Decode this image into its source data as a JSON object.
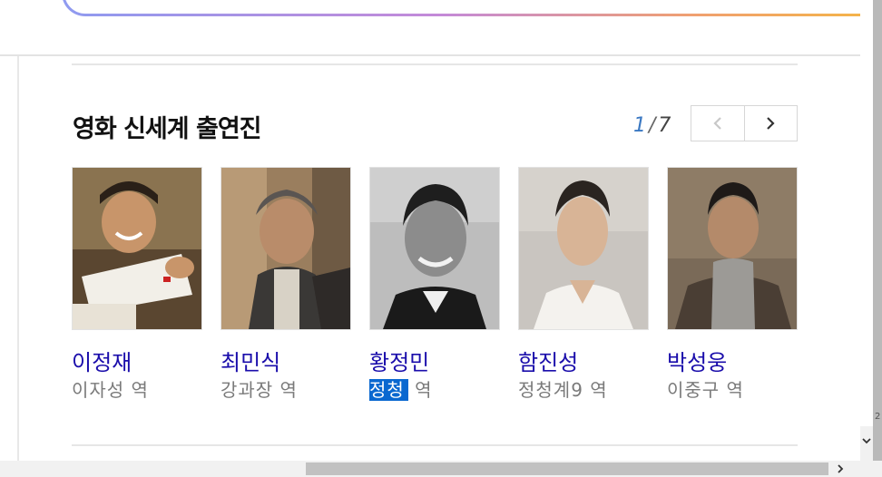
{
  "section": {
    "title": "영화 신세계 출연진",
    "pager": {
      "current": "1",
      "separator": "/",
      "total": "7"
    }
  },
  "cast": [
    {
      "name": "이정재",
      "role_parts": [
        "이자성",
        " 역"
      ],
      "photo": "actor-photo"
    },
    {
      "name": "최민식",
      "role_parts": [
        "강과장",
        " 역"
      ],
      "photo": "actor-photo"
    },
    {
      "name": "황정민",
      "role_parts": [
        "정청",
        " 역"
      ],
      "photo": "actor-photo",
      "role_highlighted": true
    },
    {
      "name": "함진성",
      "role_parts": [
        "정청계9",
        " 역"
      ],
      "photo": "actor-photo"
    },
    {
      "name": "박성웅",
      "role_parts": [
        "이중구",
        " 역"
      ],
      "photo": "actor-photo"
    }
  ],
  "scroll": {
    "marker": "2"
  },
  "icons": {
    "prev": "chevron-left-icon",
    "next": "chevron-right-icon",
    "scroll_down": "chevron-down-icon",
    "scroll_right": "chevron-right-icon"
  },
  "colors": {
    "name_link": "#1a0dab",
    "role_text": "#7a7a7a",
    "pager_current": "#3a78c2",
    "highlight": "#0a68d0"
  }
}
